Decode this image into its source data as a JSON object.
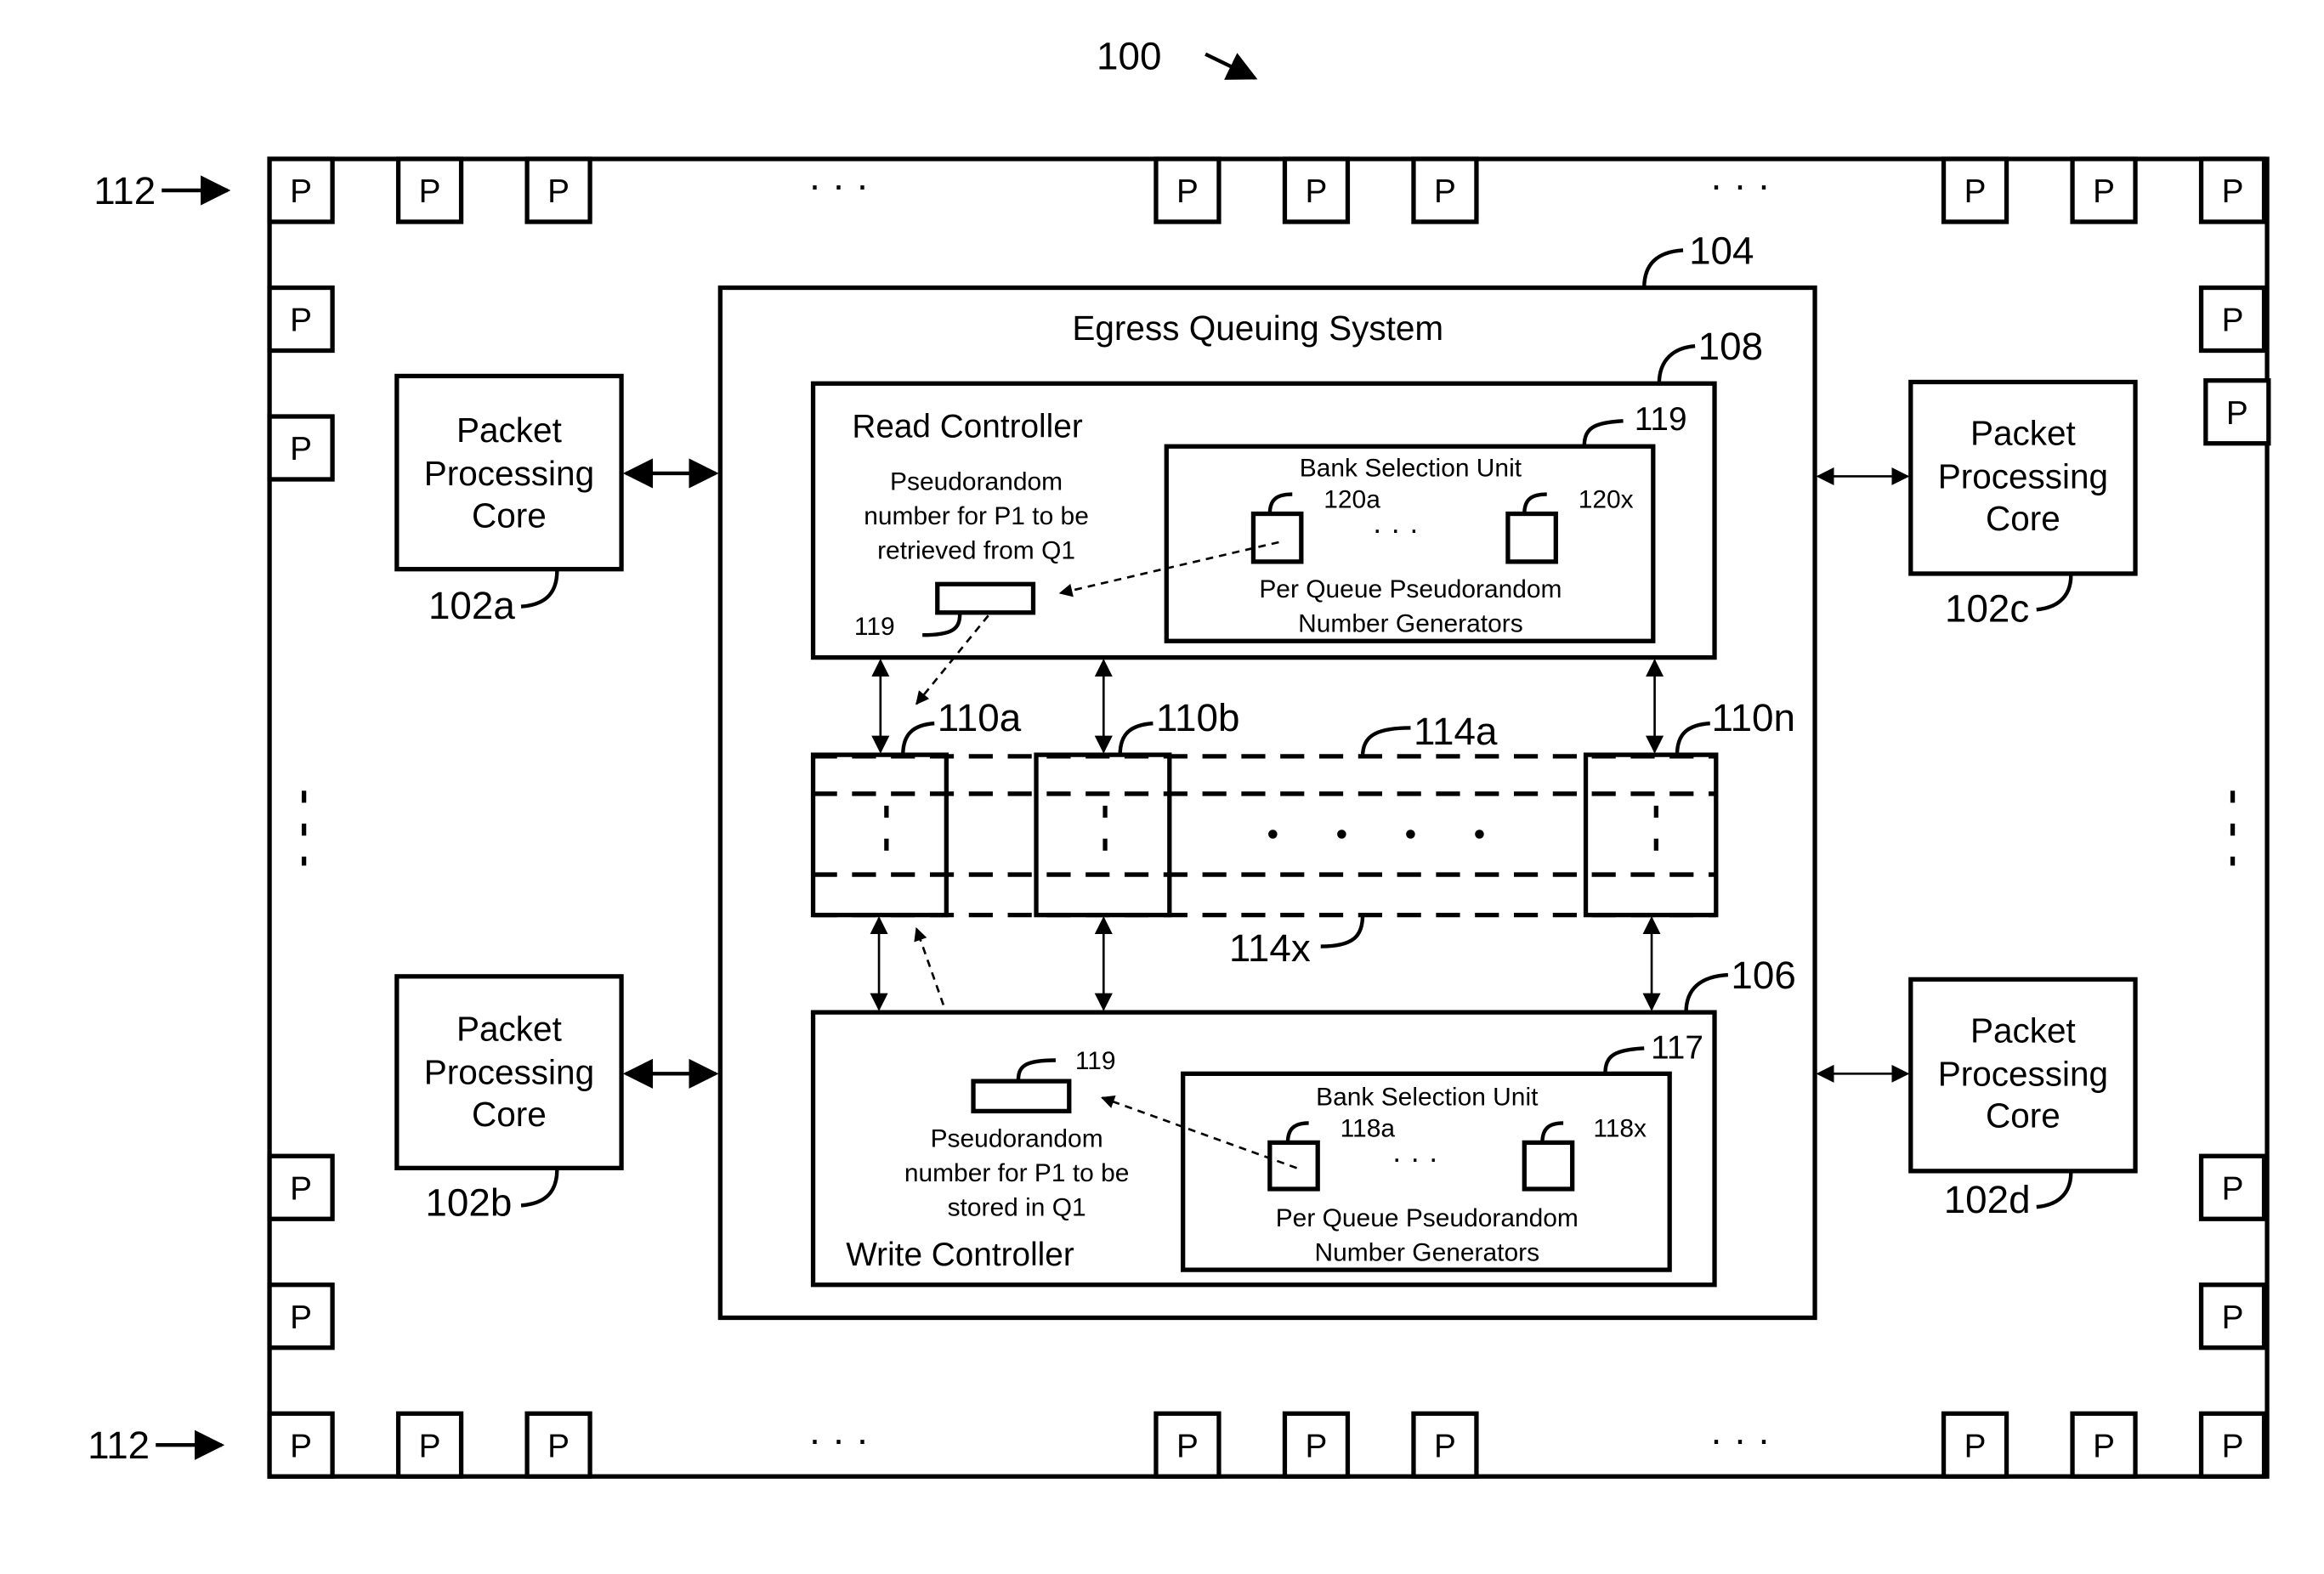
{
  "figure": {
    "ref_main": "100",
    "ref_ports": "112",
    "port_label": "P",
    "ellipsis": "· · ·"
  },
  "egress": {
    "title": "Egress Queuing System",
    "ref": "104"
  },
  "cores": [
    {
      "label_lines": [
        "Packet",
        "Processing",
        "Core"
      ],
      "ref": "102a"
    },
    {
      "label_lines": [
        "Packet",
        "Processing",
        "Core"
      ],
      "ref": "102b"
    },
    {
      "label_lines": [
        "Packet",
        "Processing",
        "Core"
      ],
      "ref": "102c"
    },
    {
      "label_lines": [
        "Packet",
        "Processing",
        "Core"
      ],
      "ref": "102d"
    }
  ],
  "read_controller": {
    "title": "Read Controller",
    "ref": "108",
    "pseudo_lines": [
      "Pseudorandom",
      "number for P1 to be",
      "retrieved from Q1"
    ],
    "register_ref": "119",
    "bank_unit": {
      "title": "Bank Selection Unit",
      "ref": "119",
      "gen_first_ref": "120a",
      "gen_last_ref": "120x",
      "caption_lines": [
        "Per Queue Pseudorandom",
        "Number Generators"
      ]
    }
  },
  "write_controller": {
    "title": "Write Controller",
    "ref": "106",
    "pseudo_lines": [
      "Pseudorandom",
      "number for P1 to be",
      "stored in Q1"
    ],
    "register_ref": "119",
    "bank_unit": {
      "title": "Bank Selection Unit",
      "ref": "117",
      "gen_first_ref": "118a",
      "gen_last_ref": "118x",
      "caption_lines": [
        "Per Queue Pseudorandom",
        "Number Generators"
      ]
    }
  },
  "memory": {
    "banks": [
      "110a",
      "110b",
      "110n"
    ],
    "queue_first_ref": "114a",
    "queue_last_ref": "114x"
  }
}
